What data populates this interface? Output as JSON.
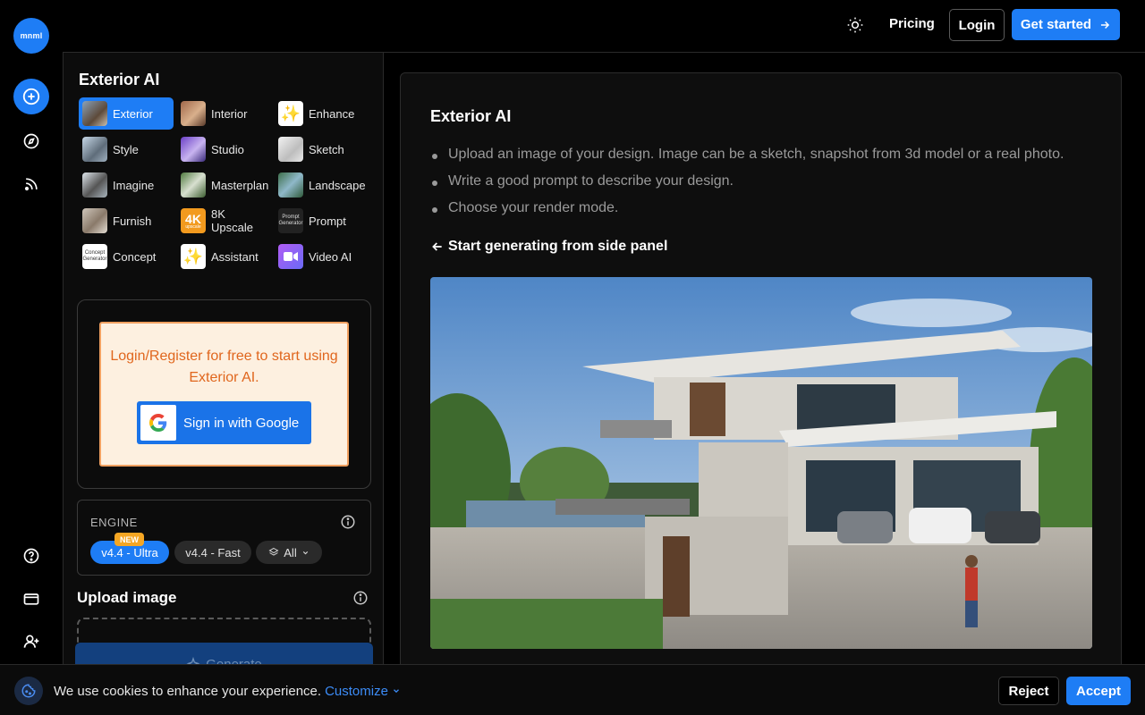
{
  "brand": {
    "logo_text": "mnml"
  },
  "rail": {
    "items": [
      "plus-icon",
      "compass-icon",
      "feed-icon"
    ],
    "bottom": [
      "help-icon",
      "card-icon",
      "user-plus-icon"
    ]
  },
  "header": {
    "pricing": "Pricing",
    "login": "Login",
    "get_started": "Get started"
  },
  "panel": {
    "title": "Exterior AI",
    "tools": [
      {
        "label": "Exterior",
        "active": true
      },
      {
        "label": "Interior"
      },
      {
        "label": "Enhance"
      },
      {
        "label": "Style"
      },
      {
        "label": "Studio"
      },
      {
        "label": "Sketch"
      },
      {
        "label": "Imagine"
      },
      {
        "label": "Masterplan"
      },
      {
        "label": "Landscape"
      },
      {
        "label": "Furnish"
      },
      {
        "label": "8K Upscale"
      },
      {
        "label": "Prompt"
      },
      {
        "label": "Concept"
      },
      {
        "label": "Assistant"
      },
      {
        "label": "Video AI"
      }
    ],
    "thumb_text": {
      "upscale": "4K",
      "upscale_sub": "upscale",
      "prompt": "Prompt Generator",
      "concept": "Concept Generator"
    },
    "login_card": {
      "message": "Login/Register for free to start using Exterior AI.",
      "google_button": "Sign in with Google"
    },
    "engine": {
      "label": "ENGINE",
      "options": [
        "v4.4 - Ultra",
        "v4.4 - Fast",
        "All"
      ],
      "new_badge": "NEW"
    },
    "upload_title": "Upload image",
    "generate": "Generate"
  },
  "content": {
    "title": "Exterior AI",
    "bullets": [
      "Upload an image of your design. Image can be a sketch, snapshot from 3d model or a real photo.",
      "Write a good prompt to describe your design.",
      "Choose your render mode."
    ],
    "start_line": "Start generating from side panel"
  },
  "cookie": {
    "text": "We use cookies to enhance your experience.",
    "customize": "Customize",
    "reject": "Reject",
    "accept": "Accept"
  },
  "colors": {
    "accent": "#1e7df5",
    "login_text": "#e0661d",
    "login_bg": "#fdf0e0",
    "new_badge": "#f5a623"
  }
}
